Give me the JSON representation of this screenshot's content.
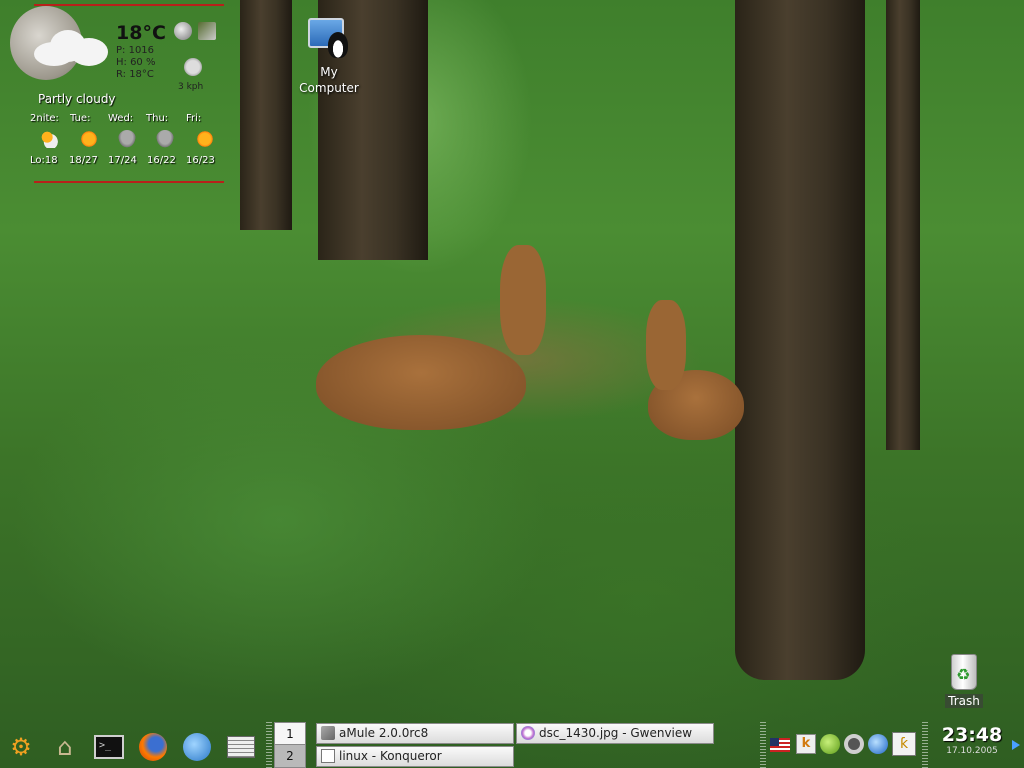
{
  "weather": {
    "temperature": "18°C",
    "pressure": "P: 1016",
    "humidity": "H: 60 %",
    "realfeel": "R: 18°C",
    "wind": "3 kph",
    "condition": "Partly cloudy",
    "forecast": [
      {
        "day": "2nite:",
        "temp": "Lo:18",
        "icon": "partly-cloudy-icon"
      },
      {
        "day": "Tue:",
        "temp": "18/27",
        "icon": "sun-icon"
      },
      {
        "day": "Wed:",
        "temp": "17/24",
        "icon": "rain-icon"
      },
      {
        "day": "Thu:",
        "temp": "16/22",
        "icon": "rain-icon"
      },
      {
        "day": "Fri:",
        "temp": "16/23",
        "icon": "sun-icon"
      }
    ]
  },
  "desktop": {
    "my_computer_line1": "My",
    "my_computer_line2": "Computer",
    "trash": "Trash"
  },
  "taskbar": {
    "launchers": [
      "kde-menu-icon",
      "home-icon",
      "terminal-icon",
      "firefox-icon",
      "kget-icon",
      "news-icon"
    ],
    "pager": [
      "1",
      "2"
    ],
    "tasks": [
      {
        "label": "aMule 2.0.0rc8",
        "icon": "amule-icon"
      },
      {
        "label": "dsc_1430.jpg - Gwenview",
        "icon": "gwenview-icon"
      },
      {
        "label": "linux - Konqueror",
        "icon": "konqueror-icon"
      }
    ],
    "tray": [
      "us-flag-icon",
      "klipper-icon",
      "kopete-icon",
      "network-icon",
      "globe-icon",
      "kpowersave-icon"
    ],
    "clock_time": "23:48",
    "clock_date": "17.10.2005"
  }
}
